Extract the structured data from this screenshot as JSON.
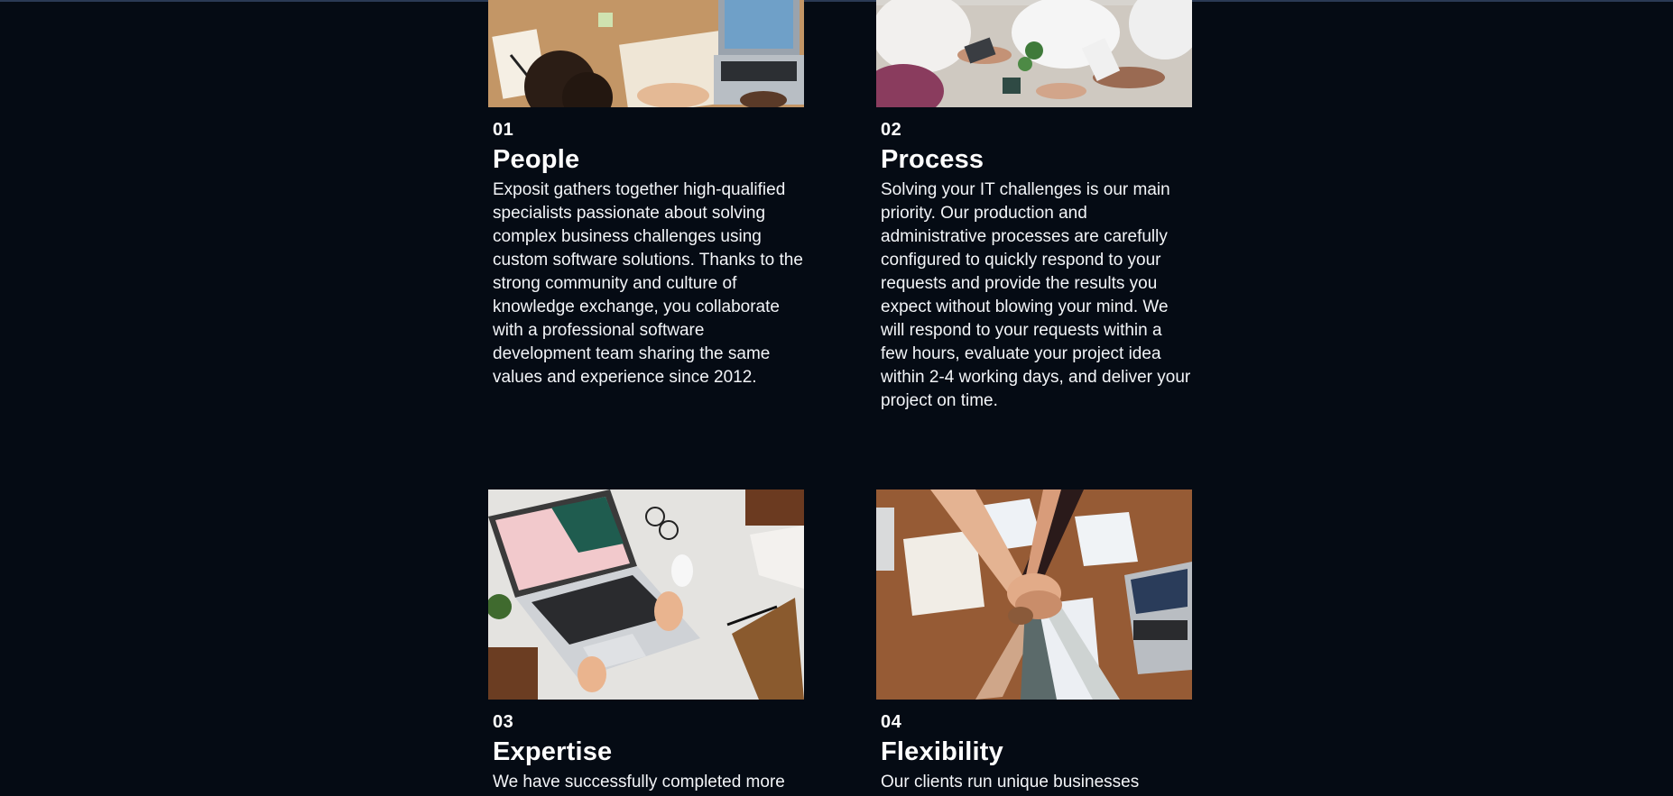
{
  "cards": [
    {
      "number": "01",
      "title": "People",
      "text": "Exposit gathers together high-qualified specialists passionate about solving complex business challenges using custom software solutions. Thanks to the strong community and culture of knowledge exchange, you collaborate with a professional software development team sharing the same values and experience since 2012.",
      "image": "desk-notebook-laptop-photo"
    },
    {
      "number": "02",
      "title": "Process",
      "text": "Solving your IT challenges is our main priority. Our production and administrative processes are carefully configured to quickly respond to your requests and provide the results you expect without blowing your mind. We will respond to your requests within a few hours, evaluate your project idea within 2-4 working days, and deliver your project on time.",
      "image": "team-meeting-table-photo"
    },
    {
      "number": "03",
      "title": "Expertise",
      "text": "We have successfully completed more",
      "image": "laptop-marble-desk-photo"
    },
    {
      "number": "04",
      "title": "Flexibility",
      "text": "Our clients run unique businesses",
      "image": "team-hands-together-photo"
    }
  ],
  "colors": {
    "background": "#050b14",
    "text": "#ffffff"
  }
}
